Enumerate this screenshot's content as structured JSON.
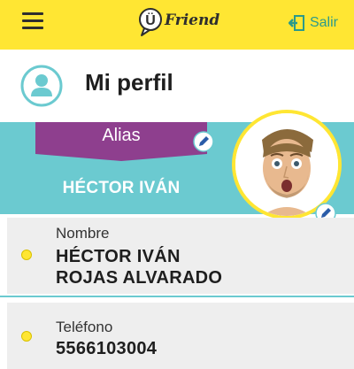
{
  "header": {
    "menu_icon": "hamburger-menu-icon",
    "brand_mark": "Ü",
    "brand_word": "Friend",
    "logout_label": "Salir",
    "logout_icon": "exit-icon",
    "colors": {
      "bar": "#ffe633",
      "accent": "#2c9a8a"
    }
  },
  "profile": {
    "title": "Mi perfil",
    "icon": "user-avatar-icon"
  },
  "alias": {
    "label": "Alias",
    "value": "HÉCTOR IVÁN",
    "edit_icon": "pencil-edit-icon",
    "colors": {
      "band": "#6bcad0",
      "tag": "#8e3f8e"
    }
  },
  "photo": {
    "edit_icon": "pencil-edit-icon"
  },
  "fields": {
    "name": {
      "label": "Nombre",
      "line1": "HÉCTOR IVÁN",
      "line2": "ROJAS ALVARADO"
    },
    "phone": {
      "label": "Teléfono",
      "value": "5566103004"
    }
  }
}
